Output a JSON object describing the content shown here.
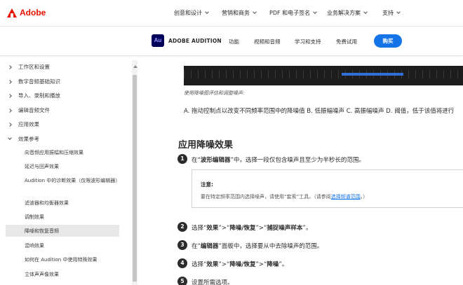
{
  "brand": {
    "name": "Adobe",
    "color": "#eb1000"
  },
  "topnav": [
    "创意和设计",
    "营销和商务",
    "PDF 和电子签名",
    "业务解决方案",
    "支持"
  ],
  "product": {
    "icon_text": "Au",
    "name": "ADOBE AUDITION",
    "nav": [
      "功能",
      "视频和音频",
      "学习和支持",
      "免费试用"
    ],
    "buy_label": "购买",
    "buy_color": "#1473e6"
  },
  "sidebar": {
    "items": [
      {
        "label": "工作区和设置",
        "state": "collapsed"
      },
      {
        "label": "数字音频基础知识",
        "state": "collapsed"
      },
      {
        "label": "导入、录制和播放",
        "state": "collapsed"
      },
      {
        "label": "编辑音频文件",
        "state": "collapsed"
      },
      {
        "label": "应用效果",
        "state": "collapsed"
      },
      {
        "label": "效果参考",
        "state": "expanded"
      }
    ],
    "subitems": [
      "向音频应用振幅和压缩效果",
      "延迟与回声效果",
      "Audition 中的诊断效果（仅限波形编辑器）",
      "滤波器和均衡器效果",
      "调制效果",
      "降噪和恢复音频",
      "混响效果",
      "如何在 Audition 中使用特殊效果",
      "立体声声像效果"
    ],
    "active_subitem": "降噪和恢复音频"
  },
  "content": {
    "caption": "使用降噪图评估和调整噪声:",
    "legend": "A. 拖动控制点以改变不同频率范围中的降噪值 B. 低振幅噪声 C. 高振幅噪声 D. 阈值，低于该值将进行",
    "section_title": "应用降噪效果",
    "steps": [
      {
        "num": "1",
        "pre": "在“",
        "bold": "波形编辑器",
        "post": "”中，选择一段仅包含噪声且至少为半秒长的范围。"
      },
      {
        "num": "2",
        "pre": "选择“",
        "bold": "效果",
        "mid": "”>“",
        "bold2": "降噪/恢复",
        "mid2": "”>“",
        "bold3": "捕捉噪声样本",
        "post": "”。"
      },
      {
        "num": "3",
        "pre": "在“",
        "bold": "编辑器",
        "post": "”面板中，选择要从中去除噪声的范围。"
      },
      {
        "num": "4",
        "pre": "选择“",
        "bold": "效果",
        "mid": "”>“",
        "bold2": "降噪/恢复",
        "mid2": "”>“",
        "bold3": "降噪",
        "post": "”。"
      },
      {
        "num": "5",
        "pre": "设置所需选项。",
        "bold": "",
        "post": ""
      }
    ],
    "note": {
      "title": "注意:",
      "body_pre": "要在特定频率范围内选择噪声，请使用“套索”工具。（请参阅",
      "link": "选择频谱范围",
      "body_post": "。）"
    }
  }
}
